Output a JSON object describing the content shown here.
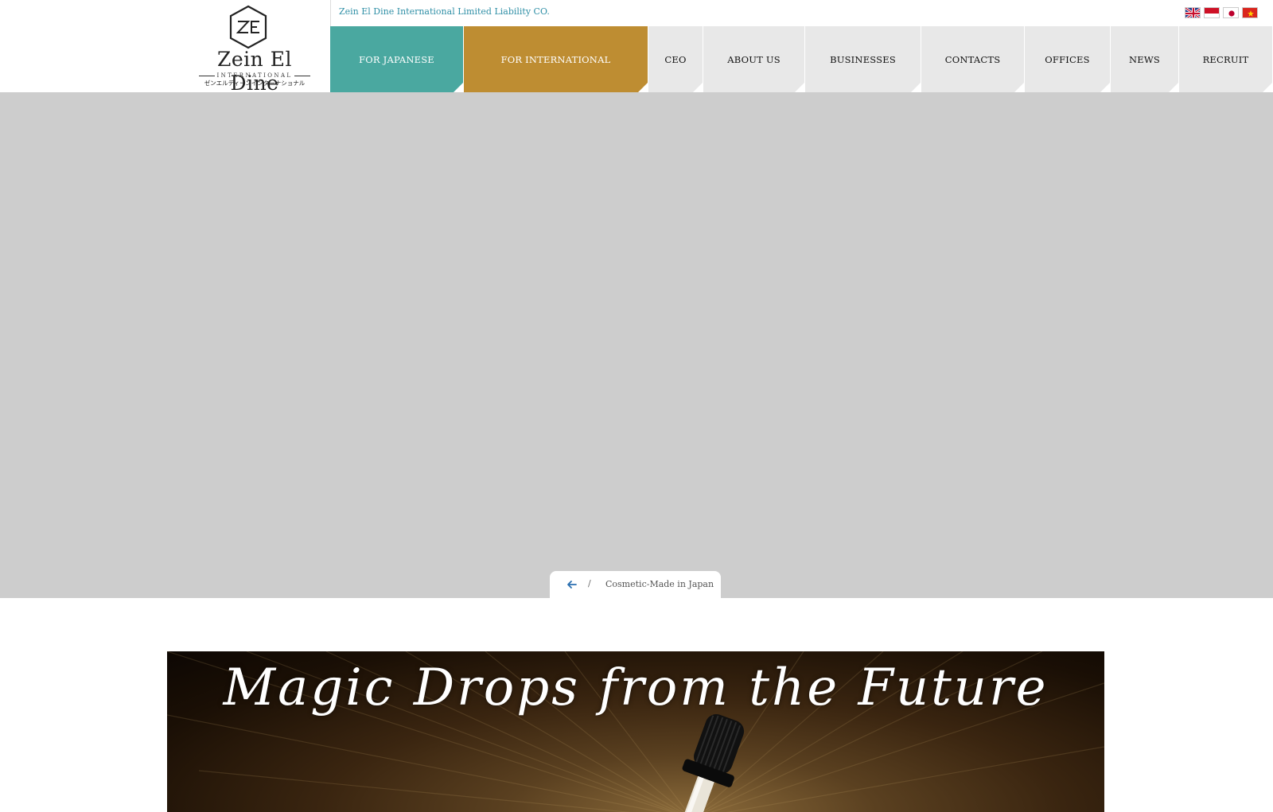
{
  "brand": {
    "name": "Zein El Dine",
    "subtitle": "INTERNATIONAL",
    "kana": "ゼンエルディーンインターナショナル",
    "company_full": "Zein El Dine International Limited Liability CO."
  },
  "languages": [
    {
      "name": "english-flag"
    },
    {
      "name": "indonesian-flag"
    },
    {
      "name": "japanese-flag"
    },
    {
      "name": "vietnamese-flag"
    }
  ],
  "nav": {
    "for_japanese": "FOR JAPANESE",
    "for_international": "FOR INTERNATIONAL",
    "ceo": "CEO",
    "about": "ABOUT US",
    "businesses": "BUSINESSES",
    "contacts": "CONTACTS",
    "offices": "OFFICES",
    "news": "NEWS",
    "recruit": "RECRUIT"
  },
  "breadcrumb": {
    "separator": "/",
    "current": "Cosmetic-Made in Japan"
  },
  "banner": {
    "title": "Magic Drops from the Future"
  },
  "colors": {
    "japanese": "#4aa8a0",
    "international": "#be8d32",
    "nav_bg": "#e8e8e8",
    "hero_bg": "#cdcdcd",
    "company_text": "#2f8fa6"
  }
}
